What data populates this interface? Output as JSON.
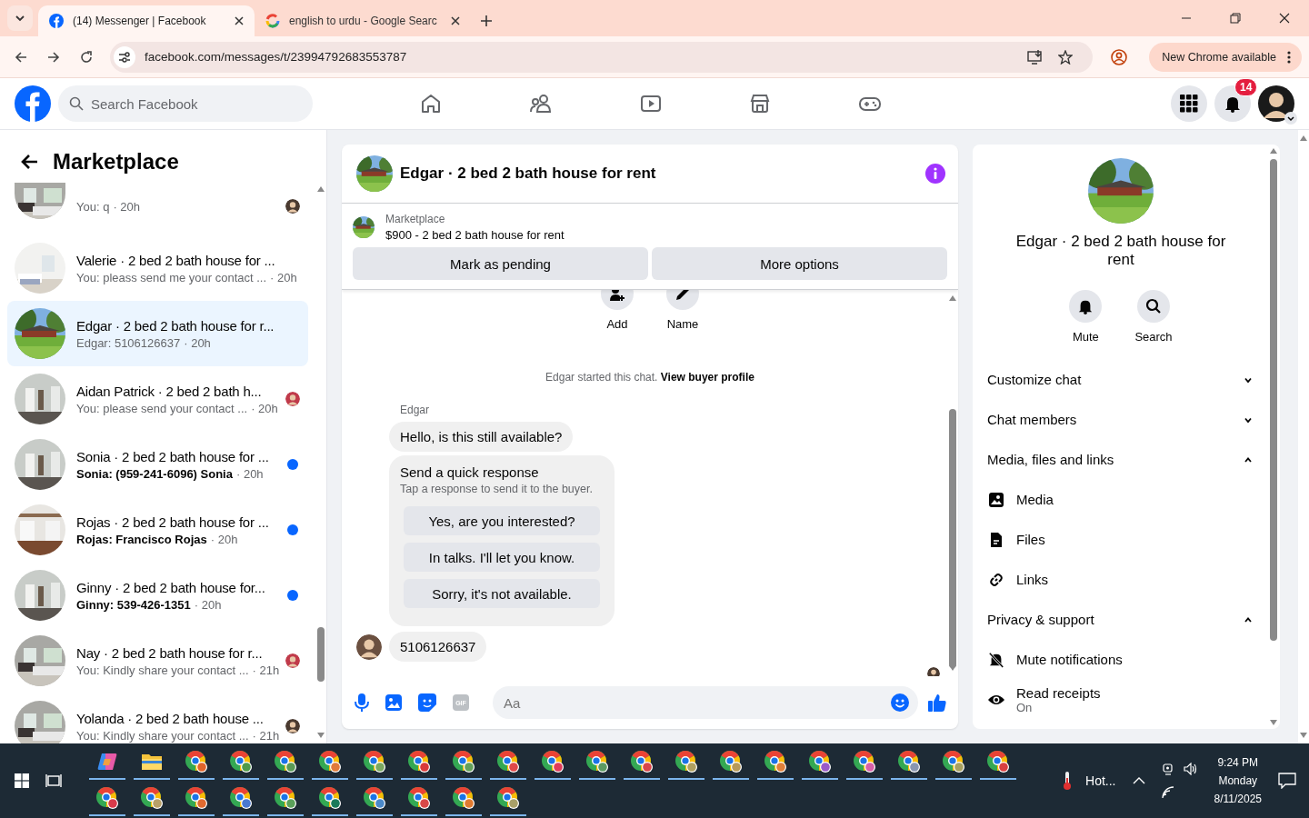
{
  "browser": {
    "tabs": [
      {
        "title": "(14) Messenger | Facebook",
        "selected": true
      },
      {
        "title": "english to urdu - Google Searc",
        "selected": false
      }
    ],
    "url": "facebook.com/messages/t/23994792683553787",
    "update_label": "New Chrome available"
  },
  "facebook": {
    "search_placeholder": "Search Facebook",
    "notification_count": "14"
  },
  "sidebar": {
    "title": "Marketplace",
    "conversations": [
      {
        "preview": "You: q",
        "time": "· 20h",
        "unread": false,
        "seen": true,
        "selected": false
      },
      {
        "title": "Valerie · 2 bed 2 bath house for ...",
        "preview": "You: pleass send me your contact ...",
        "time": "· 20h",
        "unread": false,
        "seen": false,
        "selected": false
      },
      {
        "title": "Edgar · 2 bed 2 bath house for r...",
        "preview": "Edgar: 5106126637",
        "time": "· 20h",
        "unread": false,
        "seen": false,
        "selected": true
      },
      {
        "title": "Aidan Patrick · 2 bed 2 bath h...",
        "preview": "You: please send your contact ...",
        "time": "· 20h",
        "unread": false,
        "seen": true,
        "selected": false
      },
      {
        "title": "Sonia · 2 bed 2 bath house for ...",
        "preview": "Sonia: (959-241-6096) Sonia",
        "time": "· 20h",
        "unread": true,
        "selected": false
      },
      {
        "title": "Rojas · 2 bed 2 bath house for ...",
        "preview": "Rojas: Francisco Rojas",
        "time": "· 20h",
        "unread": true,
        "selected": false
      },
      {
        "title": "Ginny · 2 bed 2 bath house for...",
        "preview": "Ginny: 539-426-1351",
        "time": "· 20h",
        "unread": true,
        "selected": false
      },
      {
        "title": "Nay · 2 bed 2 bath house for r...",
        "preview": "You: Kindly share your contact ...",
        "time": "· 21h",
        "unread": false,
        "seen": true,
        "selected": false
      },
      {
        "title": "Yolanda · 2 bed 2 bath house ...",
        "preview": "You: Kindly share your contact ...",
        "time": "· 21h",
        "unread": false,
        "seen": true,
        "selected": false
      }
    ]
  },
  "chat": {
    "title": "Edgar · 2 bed 2 bath house for rent",
    "listing": {
      "label": "Marketplace",
      "text": "$900 - 2 bed 2 bath house for rent"
    },
    "listing_buttons": [
      "Mark as pending",
      "More options"
    ],
    "actions": [
      "Add",
      "Name"
    ],
    "system_text": "Edgar started this chat.",
    "system_link": "View buyer profile",
    "sender": "Edgar",
    "first_message": "Hello, is this still available?",
    "quick_response": {
      "title": "Send a quick response",
      "hint": "Tap a response to send it to the buyer.",
      "options": [
        "Yes, are you interested?",
        "In talks. I'll let you know.",
        "Sorry, it's not available."
      ]
    },
    "last_message": "5106126637",
    "composer": {
      "gif_label": "GIF",
      "placeholder": "Aa"
    }
  },
  "details": {
    "title": "Edgar · 2 bed 2 bath house for rent",
    "actions": [
      "Mute",
      "Search"
    ],
    "sections": [
      {
        "label": "Customize chat",
        "expanded": false
      },
      {
        "label": "Chat members",
        "expanded": false
      },
      {
        "label": "Media, files and links",
        "expanded": true,
        "items": [
          {
            "label": "Media"
          },
          {
            "label": "Files"
          },
          {
            "label": "Links"
          }
        ]
      },
      {
        "label": "Privacy & support",
        "expanded": true,
        "items": [
          {
            "label": "Mute notifications"
          },
          {
            "label": "Read receipts",
            "sub": "On"
          }
        ]
      }
    ]
  },
  "taskbar": {
    "rows": [
      [
        {
          "kind": "copilot"
        },
        {
          "kind": "explorer"
        },
        {
          "kind": "chrome",
          "color": "#e0642a"
        },
        {
          "kind": "chrome",
          "color": "#4f9a4a"
        },
        {
          "kind": "chrome",
          "color": "#5a9a55"
        },
        {
          "kind": "chrome",
          "color": "#e07a3a"
        },
        {
          "kind": "chrome",
          "color": "#7aa860"
        },
        {
          "kind": "chrome",
          "color": "#d93a3a"
        },
        {
          "kind": "chrome",
          "color": "#64a05a"
        },
        {
          "kind": "chrome",
          "color": "#e04848"
        },
        {
          "kind": "chrome",
          "color": "#e03c5a"
        },
        {
          "kind": "chrome",
          "color": "#5c9a62"
        },
        {
          "kind": "chrome",
          "color": "#d9454a"
        },
        {
          "kind": "chrome",
          "color": "#b0a060"
        },
        {
          "kind": "chrome",
          "color": "#b89a5a"
        },
        {
          "kind": "chrome",
          "color": "#e0803a"
        },
        {
          "kind": "chrome",
          "color": "#9a5ac8"
        },
        {
          "kind": "chrome",
          "color": "#d860a8"
        },
        {
          "kind": "chrome",
          "color": "#8a96b0"
        },
        {
          "kind": "chrome",
          "color": "#a8a060"
        },
        {
          "kind": "chrome",
          "color": "#d84040"
        }
      ],
      [
        {
          "kind": "chrome",
          "color": "#d83a4a"
        },
        {
          "kind": "chrome",
          "color": "#b8a068"
        },
        {
          "kind": "chrome",
          "color": "#e06a30"
        },
        {
          "kind": "chrome",
          "color": "#4a78d0"
        },
        {
          "kind": "chrome",
          "color": "#5aa05a"
        },
        {
          "kind": "chrome",
          "color": "#1a7a5a"
        },
        {
          "kind": "chrome",
          "color": "#4a88c8"
        },
        {
          "kind": "chrome",
          "color": "#d84848"
        },
        {
          "kind": "chrome",
          "color": "#e07a30"
        },
        {
          "kind": "chrome",
          "color": "#a8a068"
        }
      ]
    ],
    "weather": "Hot...",
    "time": "9:24 PM",
    "day": "Monday",
    "date": "8/11/2025"
  }
}
